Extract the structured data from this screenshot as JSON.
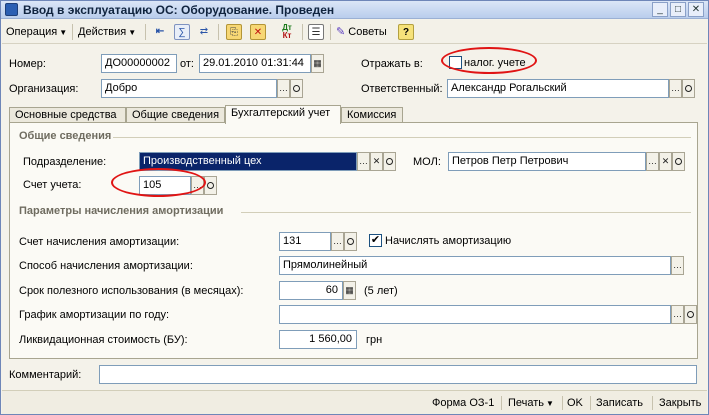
{
  "window": {
    "title": "Ввод в эксплуатацию ОС: Оборудование. Проведен"
  },
  "toolbar": {
    "operation": "Операция",
    "actions": "Действия",
    "kt_top": "Дт",
    "kt_bottom": "Кт",
    "tips": "Советы",
    "help": "?"
  },
  "header": {
    "number_label": "Номер:",
    "number_value": "ДО00000002",
    "date_label": "от:",
    "date_value": "29.01.2010 01:31:44",
    "reflect_label": "Отражать в:",
    "tax_label": "налог. учете",
    "tax_checked": false,
    "org_label": "Организация:",
    "org_value": "Добро",
    "resp_label": "Ответственный:",
    "resp_value": "Александр Рогальский"
  },
  "tabs": [
    {
      "label": "Основные средства",
      "active": false
    },
    {
      "label": "Общие сведения",
      "active": false
    },
    {
      "label": "Бухгалтерский учет",
      "active": true
    },
    {
      "label": "Комиссия",
      "active": false
    }
  ],
  "accounting": {
    "general_title": "Общие сведения",
    "dept_label": "Подразделение:",
    "dept_value": "Производственный цех",
    "mol_label": "МОЛ:",
    "mol_value": "Петров Петр Петрович",
    "account_label": "Счет учета:",
    "account_value": "105",
    "depr_title": "Параметры начисления амортизации",
    "depr_account_label": "Счет начисления амортизации:",
    "depr_account_value": "131",
    "accrue_label": "Начислять амортизацию",
    "accrue_checked": true,
    "method_label": "Способ начисления амортизации:",
    "method_value": "Прямолинейный",
    "life_label": "Срок полезного использования (в месяцах):",
    "life_value": "60",
    "life_years": "(5 лет)",
    "schedule_label": "График амортизации по году:",
    "schedule_value": "",
    "salvage_label": "Ликвидационная стоимость (БУ):",
    "salvage_value": "1 560,00",
    "currency": "грн"
  },
  "footer": {
    "comment_label": "Комментарий:",
    "comment_value": ""
  },
  "bottom": {
    "form": "Форма ОЗ-1",
    "print": "Печать",
    "ok": "OK",
    "save": "Записать",
    "close": "Закрыть"
  },
  "colors": {
    "highlight_oval": "#e01414",
    "selection": "#0a246a"
  }
}
